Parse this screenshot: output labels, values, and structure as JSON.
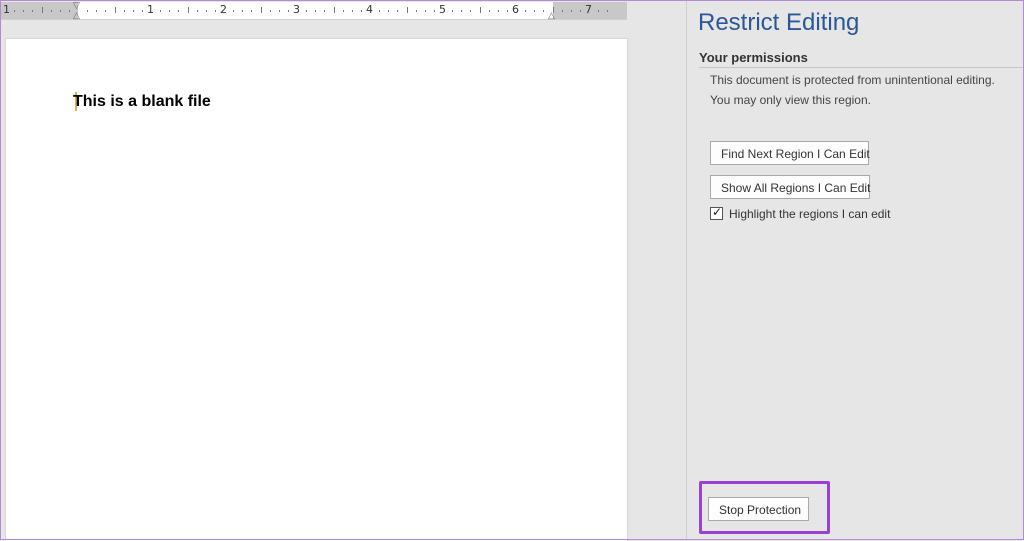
{
  "ruler": {
    "numbers": [
      "1",
      "1",
      "2",
      "3",
      "4",
      "5",
      "6",
      "7"
    ]
  },
  "document": {
    "text": "This is a blank file"
  },
  "pane": {
    "title": "Restrict Editing",
    "section_heading": "Your permissions",
    "info_line1": "This document is protected from unintentional editing.",
    "info_line2": "You may only view this region.",
    "find_next_label": "Find Next Region I Can Edit",
    "show_all_label": "Show All Regions I Can Edit",
    "highlight_label": "Highlight the regions I can edit",
    "highlight_checked": true,
    "checkmark": "✓",
    "stop_protection_label": "Stop Protection"
  },
  "colors": {
    "accent_title": "#2b5797",
    "highlight_border": "#9b3fdb",
    "frame": "#b48ad6"
  }
}
